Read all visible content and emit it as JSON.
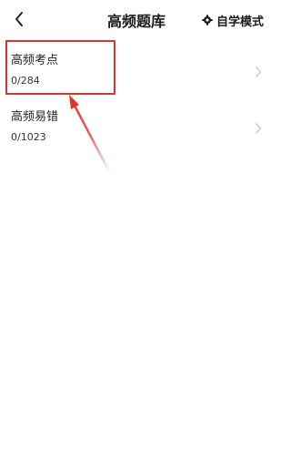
{
  "header": {
    "title": "高频题库",
    "mode_label": "自学模式"
  },
  "items": [
    {
      "title": "高频考点",
      "count": "0/284"
    },
    {
      "title": "高频易错",
      "count": "0/1023"
    }
  ],
  "icons": {
    "back": "back-chevron-icon",
    "mode": "gear-icon",
    "row": "chevron-right-icon"
  },
  "colors": {
    "annotation": "#e0322f",
    "chevron": "#c8c8c8"
  }
}
